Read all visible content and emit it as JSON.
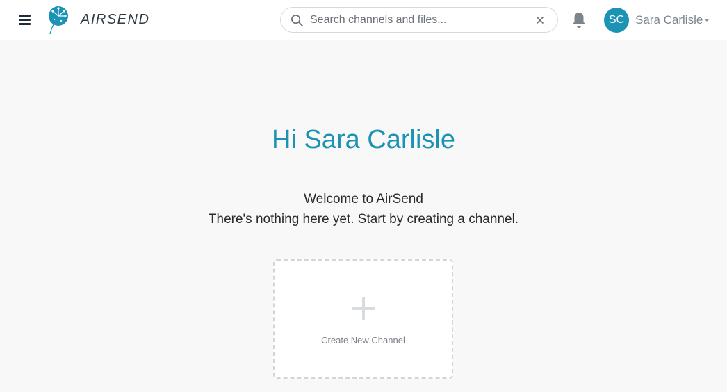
{
  "header": {
    "brand": "AIRSEND",
    "search": {
      "placeholder": "Search channels and files...",
      "value": ""
    },
    "user": {
      "initials": "SC",
      "name": "Sara Carlisle"
    }
  },
  "main": {
    "greeting": "Hi Sara Carlisle",
    "welcome": "Welcome to AirSend",
    "empty_message": "There's nothing here yet. Start by creating a channel.",
    "create_card_label": "Create New Channel"
  },
  "icons": {
    "menu": "hamburger-menu-icon",
    "logo": "dandelion-logo-icon",
    "search": "search-icon",
    "clear": "close-icon",
    "notifications": "bell-icon",
    "dropdown": "caret-down-icon",
    "create": "plus-icon"
  },
  "colors": {
    "accent": "#1a93b5",
    "background": "#f8f8f8",
    "header_bg": "#ffffff",
    "text": "#2b2b2b",
    "muted_text": "#7d858c"
  }
}
